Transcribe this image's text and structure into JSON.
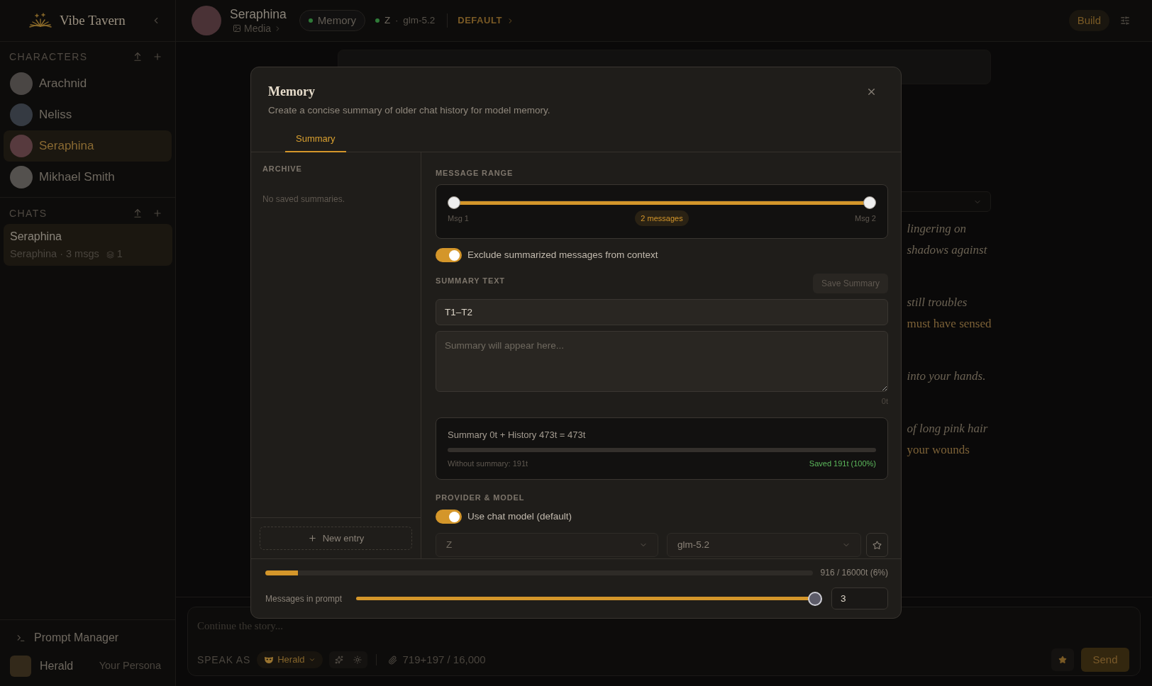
{
  "sidebar": {
    "brand": "Vibe Tavern",
    "characters_heading": "CHARACTERS",
    "characters": [
      {
        "name": "Arachnid",
        "selected": false
      },
      {
        "name": "Neliss",
        "selected": false
      },
      {
        "name": "Seraphina",
        "selected": true
      },
      {
        "name": "Mikhael Smith",
        "selected": false
      }
    ],
    "chats_heading": "CHATS",
    "chats": [
      {
        "title": "Seraphina",
        "meta": "Seraphina · 3 msgs",
        "count": "1",
        "selected": true
      }
    ],
    "prompt_manager": "Prompt Manager",
    "persona": {
      "name": "Herald",
      "role": "Your Persona"
    }
  },
  "header": {
    "character": "Seraphina",
    "media": "Media",
    "memory": "Memory",
    "provider": "Z",
    "separator": "·",
    "model": "glm-5.2",
    "preset": "DEFAULT",
    "build": "Build"
  },
  "chat": {
    "paragraphs": [
      {
        "lines": [
          {
            "text": "lingering on",
            "kind": "narration"
          },
          {
            "text": "shadows against",
            "kind": "narration"
          }
        ]
      },
      {
        "lines": [
          {
            "text": "still troubles",
            "kind": "narration"
          },
          {
            "text": "must have sensed",
            "kind": "speech"
          }
        ]
      },
      {
        "lines": [
          {
            "text": "into your hands.",
            "kind": "narration"
          }
        ]
      },
      {
        "lines": [
          {
            "text": "of long pink hair",
            "kind": "narration"
          },
          {
            "text": "your wounds",
            "kind": "speech"
          }
        ]
      }
    ]
  },
  "composer": {
    "placeholder": "Continue the story...",
    "speak_as": "SPEAK AS",
    "persona": "Herald",
    "tokens": "719+197 / 16,000",
    "send": "Send"
  },
  "modal": {
    "title": "Memory",
    "description": "Create a concise summary of older chat history for model memory.",
    "tabs": [
      {
        "label": "Summary",
        "selected": true
      }
    ],
    "archive": {
      "heading": "ARCHIVE",
      "empty": "No saved summaries.",
      "new_entry": "New entry"
    },
    "range": {
      "heading": "MESSAGE RANGE",
      "low": {
        "level": 0
      },
      "high": {
        "level": 1
      },
      "start_label": "Msg 1",
      "end_label": "Msg 2",
      "count": "2 messages"
    },
    "exclude": {
      "label": "Exclude summarized messages from context",
      "on": true
    },
    "summary": {
      "heading": "SUMMARY TEXT",
      "save": {
        "label": "Save Summary",
        "disabled": true
      },
      "title": "T1–T2",
      "placeholder": "Summary will appear here...",
      "tokens": "0t"
    },
    "stats": {
      "formula": "Summary 0t + History 473t = 473t",
      "without": "Without summary: 191t",
      "saved": "Saved 191t (100%)"
    },
    "provider": {
      "heading": "PROVIDER & MODEL",
      "use_chat_model": {
        "label": "Use chat model (default)",
        "on": true
      },
      "provider": "Z",
      "model": "glm-5.2"
    },
    "context": {
      "level": 0.06,
      "reading": "916 / 16000t (6%)"
    },
    "messages_in_prompt": {
      "label": "Messages in prompt",
      "level": 1,
      "value": "3"
    }
  }
}
